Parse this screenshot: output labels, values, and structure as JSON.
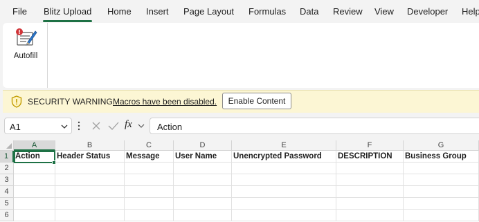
{
  "tabs": [
    {
      "label": "File",
      "active": false
    },
    {
      "label": "Blitz Upload",
      "active": true
    },
    {
      "label": "Home",
      "active": false
    },
    {
      "label": "Insert",
      "active": false
    },
    {
      "label": "Page Layout",
      "active": false
    },
    {
      "label": "Formulas",
      "active": false
    },
    {
      "label": "Data",
      "active": false
    },
    {
      "label": "Review",
      "active": false
    },
    {
      "label": "View",
      "active": false
    },
    {
      "label": "Developer",
      "active": false
    },
    {
      "label": "Help",
      "active": false
    }
  ],
  "ribbon": {
    "autofill_label": "Autofill",
    "autofill_icon": "autofill-icon"
  },
  "security_bar": {
    "title": "SECURITY WARNING",
    "message": "Macros have been disabled.",
    "button_label": "Enable Content",
    "icon": "shield-warning-icon"
  },
  "formula_bar": {
    "name_box": "A1",
    "fx_label": "fx",
    "formula_value": "Action"
  },
  "grid": {
    "columns": [
      "A",
      "B",
      "C",
      "D",
      "E",
      "F",
      "G"
    ],
    "rows": [
      "1",
      "2",
      "3",
      "4",
      "5",
      "6"
    ],
    "selected_cell": "A1",
    "header_row": [
      "Action",
      "Header Status",
      "Message",
      "User Name",
      "Unencrypted Password",
      "DESCRIPTION",
      "Business Group"
    ]
  },
  "colors": {
    "accent": "#1e7145",
    "warning_bar": "#fcf6d4",
    "warning_icon": "#c19c00"
  }
}
